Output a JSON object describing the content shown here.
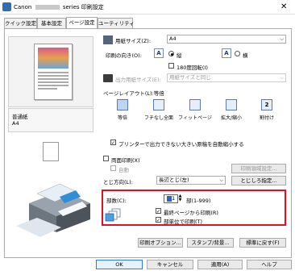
{
  "window": {
    "title_prefix": "Canon",
    "title_suffix": "series 印刷設定"
  },
  "tabs": [
    {
      "label": "クイック設定"
    },
    {
      "label": "基本設定"
    },
    {
      "label": "ページ設定"
    },
    {
      "label": "ユーティリティ"
    }
  ],
  "preview": {
    "media_type": "普通紙",
    "paper_size": "A4"
  },
  "page": {
    "paper_size_label": "用紙サイズ(Z):",
    "paper_size_value": "A4",
    "orientation_label": "印刷の向き(O):",
    "portrait_label": "縦",
    "landscape_label": "横",
    "rotate180_label": "180度回転(I)",
    "output_size_label": "出力用紙サイズ(E):",
    "output_size_value": "用紙サイズと同じ",
    "layout_label": "ページレイアウト(L):",
    "layout_value": "等倍",
    "layout_options": [
      "等倍",
      "フチなし全面",
      "フィットページ",
      "拡大/縮小",
      "割付け"
    ],
    "auto_reduce_label": "プリンターで出力できない大きい原稿を自動縮小する",
    "duplex_label": "両面印刷(X)",
    "auto_label": "自動",
    "print_area_button": "印刷領域設定...",
    "binding_label": "とじ方向(L):",
    "binding_value": "長辺とじ(左)",
    "margin_button": "とじしろ指定...",
    "copies_label": "部数(C):",
    "copies_value": "1",
    "copies_range": "部(1-999)",
    "last_page_first_label": "最終ページから印刷(R)",
    "collate_label": "部単位で印刷(T)",
    "print_options_button": "印刷オプション...",
    "stamp_button": "スタンプ/背景...",
    "defaults_button": "標準に戻す(F)"
  },
  "footer": {
    "ok": "OK",
    "cancel": "キャンセル",
    "apply": "適用(A)",
    "help": "ヘルプ"
  },
  "colors": {
    "highlight_frame": "#e0102a",
    "accent": "#2f7bd6"
  }
}
